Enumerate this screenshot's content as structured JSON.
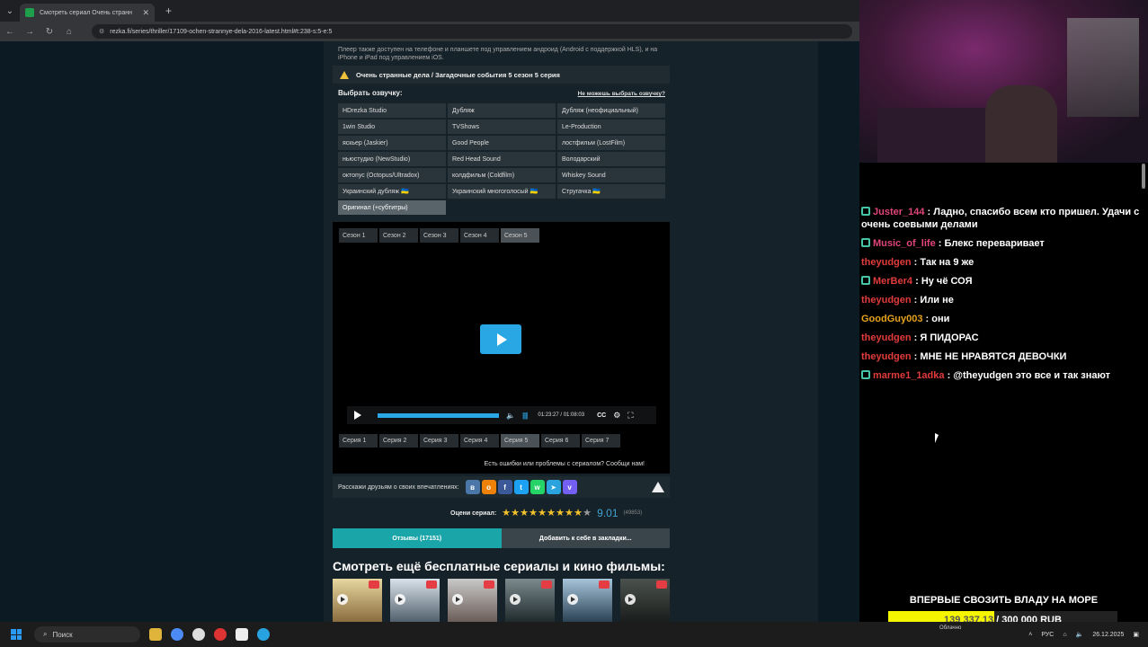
{
  "browser": {
    "tab_title": "Смотреть сериал Очень странн",
    "url": "rezka.fi/series/thriller/17109-ochen-strannye-dela-2016-latest.html#t:238-s:5-e:5"
  },
  "page": {
    "player_note": "Плеер также доступен на телефоне и планшете под управлением андроид (Android с поддержкой HLS), и на iPhone и iPad под управлением iOS.",
    "title": "Очень странные дела / Загадочные события 5 сезон 5 серия",
    "voice_header": "Выбрать озвучку:",
    "voice_help": "Не можешь выбрать озвучку?",
    "voices": [
      "HDrezka Studio",
      "Дубляж",
      "Дубляж (неофициальный)",
      "1win Studio",
      "TVShows",
      "Le-Production",
      "яскьер (Jaskier)",
      "Good People",
      "лостфильм (LostFilm)",
      "ньюстудио (NewStudio)",
      "Red Head Sound",
      "Володарский",
      "октопус (Octopus/Ultradox)",
      "колдфильм (Coldfilm)",
      "Whiskey Sound",
      "Украинский дубляж 🇺🇦",
      "Украинский многоголосый 🇺🇦",
      "Стругачка 🇺🇦",
      "Оригинал (+субтитры)"
    ],
    "seasons": [
      "Сезон 1",
      "Сезон 2",
      "Сезон 3",
      "Сезон 4",
      "Сезон 5"
    ],
    "time": "01:23:27 / 01:08:03",
    "cc": "CC",
    "episodes": [
      "Серия 1",
      "Серия 2",
      "Серия 3",
      "Серия 4",
      "Серия 5",
      "Серия 6",
      "Серия 7"
    ],
    "error_text": "Есть ошибки или проблемы с сериалом? Сообщи нам!",
    "share_text": "Расскажи друзьям о своих впечатлениях:",
    "rating_label": "Оцени сериал:",
    "rating_value": "9.01",
    "rating_votes": "(49853)",
    "rating_stars": 9,
    "tab_reviews": "Отзывы (17151)",
    "tab_bookmark": "Добавить к себе в закладки...",
    "more_title": "Смотреть ещё бесплатные сериалы и кино фильмы:"
  },
  "chat": [
    {
      "user": "Juster_144",
      "text": "Ладно, спасибо всем кто пришел. Удачи с очень соевыми делами",
      "badge": true,
      "color": "#e0457b"
    },
    {
      "user": "Music_of_life",
      "text": "Блекс переваривает",
      "badge": true,
      "color": "#e0457b"
    },
    {
      "user": "theyudgen",
      "text": "Так на 9 же",
      "badge": false,
      "color": "#e23b3b"
    },
    {
      "user": "MerBer4",
      "text": "Ну чё СОЯ",
      "badge": true,
      "color": "#e23b3b"
    },
    {
      "user": "theyudgen",
      "text": "Или не",
      "badge": false,
      "color": "#e23b3b"
    },
    {
      "user": "GoodGuy003",
      "text": "они",
      "badge": false,
      "color": "#e6a21d"
    },
    {
      "user": "theyudgen",
      "text": "Я ПИДОРАС",
      "badge": false,
      "color": "#e23b3b"
    },
    {
      "user": "theyudgen",
      "text": "МНЕ НЕ НРАВЯТСЯ ДЕВОЧКИ",
      "badge": false,
      "color": "#e23b3b"
    },
    {
      "user": "marme1_1adka",
      "text": "@theyudgen это все и так знают",
      "badge": true,
      "color": "#e23b3b"
    }
  ],
  "donation": {
    "title": "ВПЕРВЫЕ СВОЗИТЬ ВЛАДУ НА МОРЕ",
    "current": "139 337.13",
    "goal": "/ 300 000 RUB",
    "fraction": 0.4645
  },
  "taskbar": {
    "search_label": "Поиск",
    "weather": "Облачно",
    "lang": "РУС",
    "date": "26.12.2025"
  }
}
